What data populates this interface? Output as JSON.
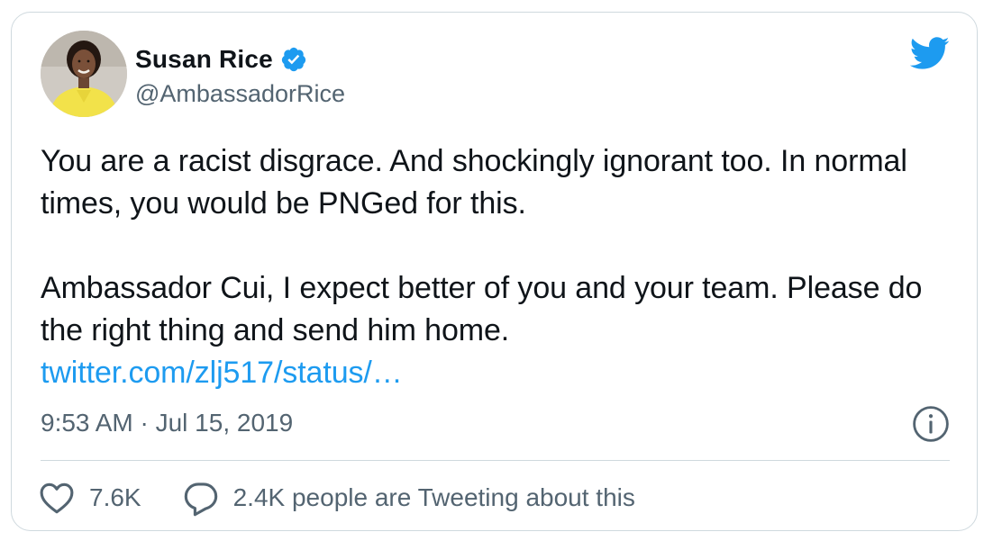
{
  "author": {
    "display_name": "Susan Rice",
    "handle": "@AmbassadorRice",
    "verified": true
  },
  "tweet": {
    "paragraph_1": "You are a racist disgrace. And shockingly ignorant too. In normal times, you would be PNGed for this.",
    "paragraph_2": "Ambassador Cui, I expect better of you and your team. Please do the right thing and send him home.",
    "link_text": "twitter.com/zlj517/status/…",
    "timestamp": "9:53 AM · Jul 15, 2019"
  },
  "actions": {
    "likes_count": "7.6K",
    "conversation_text": "2.4K people are Tweeting about this"
  },
  "icons": {
    "platform": "twitter-bird-icon",
    "verified": "verified-badge-icon",
    "info": "info-icon",
    "like": "heart-icon",
    "reply": "speech-bubble-icon"
  },
  "colors": {
    "brand_blue": "#1d9bf0",
    "text_primary": "#0f1419",
    "text_secondary": "#536471",
    "border": "#cfd9de"
  }
}
